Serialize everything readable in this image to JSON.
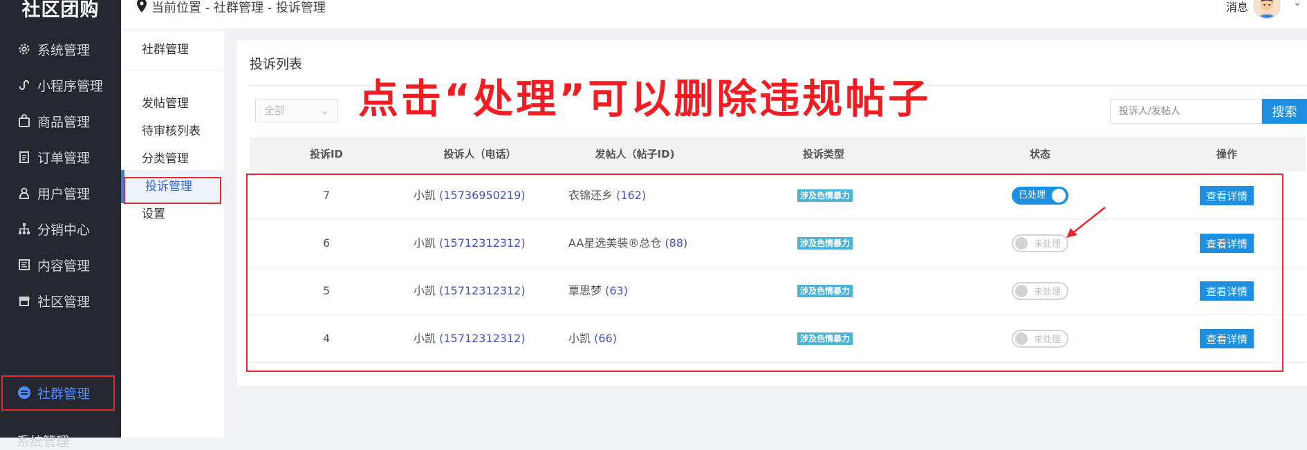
{
  "brand": "社区团购",
  "sidebar": {
    "items": [
      {
        "label": "系统管理",
        "icon": "gear-icon"
      },
      {
        "label": "小程序管理",
        "icon": "miniprogram-icon"
      },
      {
        "label": "商品管理",
        "icon": "bag-icon"
      },
      {
        "label": "订单管理",
        "icon": "clipboard-icon"
      },
      {
        "label": "用户管理",
        "icon": "user-icon"
      },
      {
        "label": "分销中心",
        "icon": "network-icon"
      },
      {
        "label": "内容管理",
        "icon": "document-icon"
      },
      {
        "label": "社区管理",
        "icon": "store-icon"
      },
      {
        "label": "社群管理",
        "icon": "group-icon"
      }
    ],
    "partial_label": "系统管理"
  },
  "topbar": {
    "breadcrumb": "当前位置 - 社群管理 - 投诉管理",
    "message_label": "消息"
  },
  "subnav": {
    "heading": "社群管理",
    "items": [
      "发帖管理",
      "待审核列表",
      "分类管理",
      "投诉管理",
      "设置"
    ]
  },
  "panel": {
    "title": "投诉列表",
    "filter_value": "全部",
    "search_placeholder": "投诉人/发帖人",
    "search_button": "搜索"
  },
  "annotation": {
    "text": "点击“处理”可以删除违规帖子",
    "color": "#f01e23"
  },
  "table": {
    "headers": [
      "投诉ID",
      "投诉人（电话）",
      "发帖人（帖子ID)",
      "投诉类型",
      "状态",
      "操作"
    ],
    "rows": [
      {
        "id": "7",
        "complainant": "小凯",
        "phone": "(15736950219)",
        "poster": "衣锦还乡",
        "post_id": "(162)",
        "type": "涉及色情暴力",
        "status": "已处理",
        "processed": true,
        "action": "查看详情"
      },
      {
        "id": "6",
        "complainant": "小凯",
        "phone": "(15712312312)",
        "poster": "AA星选美装®总仓",
        "post_id": "(88)",
        "type": "涉及色情暴力",
        "status": "未处理",
        "processed": false,
        "action": "查看详情"
      },
      {
        "id": "5",
        "complainant": "小凯",
        "phone": "(15712312312)",
        "poster": "覃思梦",
        "post_id": "(63)",
        "type": "涉及色情暴力",
        "status": "未处理",
        "processed": false,
        "action": "查看详情"
      },
      {
        "id": "4",
        "complainant": "小凯",
        "phone": "(15712312312)",
        "poster": "小凯",
        "post_id": "(66)",
        "type": "涉及色情暴力",
        "status": "未处理",
        "processed": false,
        "action": "查看详情"
      }
    ]
  },
  "colors": {
    "sidebar_bg": "#252830",
    "accent": "#1e8fe1",
    "highlight_box": "#e8262d",
    "tag_bg": "#4bb3d6"
  }
}
